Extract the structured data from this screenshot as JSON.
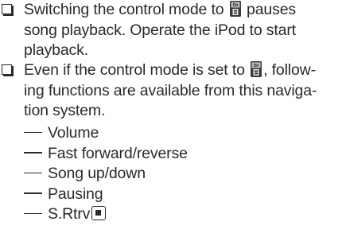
{
  "notes": [
    {
      "lines": [
        "Switching the control mode to",
        "pauses",
        "song playback. Operate the iPod to start",
        "playback."
      ]
    },
    {
      "lines": [
        "Even if the control mode is set to",
        ", follow-",
        "ing functions are available from this naviga-",
        "tion system."
      ],
      "functions": [
        "Volume",
        "Fast forward/reverse",
        "Song up/down",
        "Pausing",
        "S.Rtrv"
      ]
    }
  ],
  "icons": {
    "control_mode": "ipod-control-mode-icon",
    "checkbox": "note-checkbox-icon",
    "button": "s-rtrv-button-icon"
  }
}
